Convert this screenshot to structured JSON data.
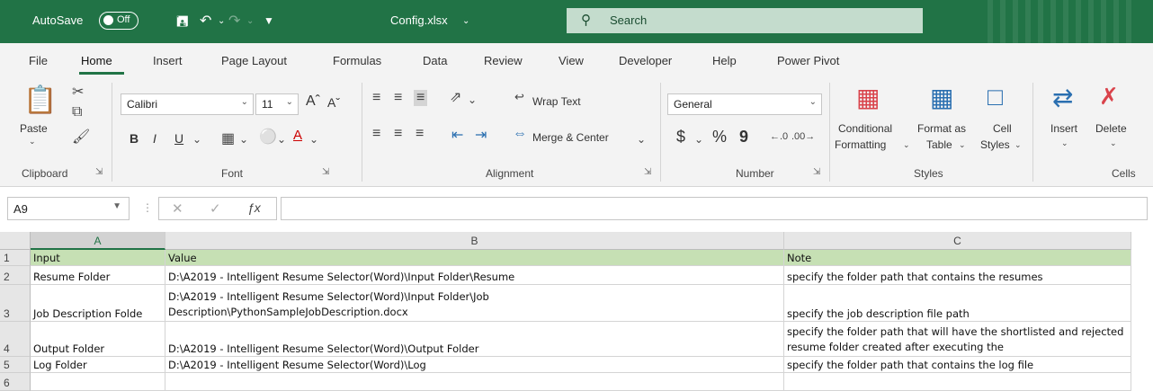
{
  "titlebar": {
    "autosave_label": "AutoSave",
    "autosave_state": "Off",
    "filename": "Config.xlsx",
    "search_placeholder": "Search"
  },
  "tabs": [
    "File",
    "Home",
    "Insert",
    "Page Layout",
    "Formulas",
    "Data",
    "Review",
    "View",
    "Developer",
    "Help",
    "Power Pivot"
  ],
  "active_tab": "Home",
  "ribbon": {
    "clipboard": {
      "paste": "Paste",
      "label": "Clipboard"
    },
    "font": {
      "name": "Calibri",
      "size": "11",
      "label": "Font",
      "bold": "B",
      "italic": "I",
      "underline": "U"
    },
    "alignment": {
      "wrap_text": "Wrap Text",
      "merge_center": "Merge & Center",
      "label": "Alignment"
    },
    "number": {
      "format": "General",
      "currency": "$",
      "percent": "%",
      "comma": "9",
      "label": "Number"
    },
    "styles": {
      "conditional": "Conditional",
      "formatting": "Formatting",
      "format_as": "Format as",
      "table": "Table",
      "cell": "Cell",
      "cell_styles": "Styles",
      "label": "Styles"
    },
    "cells": {
      "insert": "Insert",
      "delete": "Delete",
      "label": "Cells"
    }
  },
  "formula_bar": {
    "name_box": "A9",
    "formula": ""
  },
  "columns": [
    "A",
    "B",
    "C"
  ],
  "rows": [
    {
      "num": "1",
      "a": "Input",
      "b": "Value",
      "c": "Note"
    },
    {
      "num": "2",
      "a": "Resume Folder",
      "b": "D:\\A2019 - Intelligent Resume Selector(Word)\\Input Folder\\Resume",
      "c": "specify the folder path that contains the resumes"
    },
    {
      "num": "3",
      "a": "Job Description Folde",
      "b": "D:\\A2019 - Intelligent Resume Selector(Word)\\Input Folder\\Job Description\\PythonSampleJobDescription.docx",
      "c": "specify the job description file path"
    },
    {
      "num": "4",
      "a": "Output Folder",
      "b": "D:\\A2019 - Intelligent Resume Selector(Word)\\Output Folder",
      "c": "specify the folder path that will have the shortlisted and rejected resume folder created after executing the"
    },
    {
      "num": "5",
      "a": "Log Folder",
      "b": "D:\\A2019 - Intelligent Resume Selector(Word)\\Log",
      "c": "specify the folder path that contains the log file"
    },
    {
      "num": "6",
      "a": "",
      "b": "",
      "c": ""
    }
  ]
}
